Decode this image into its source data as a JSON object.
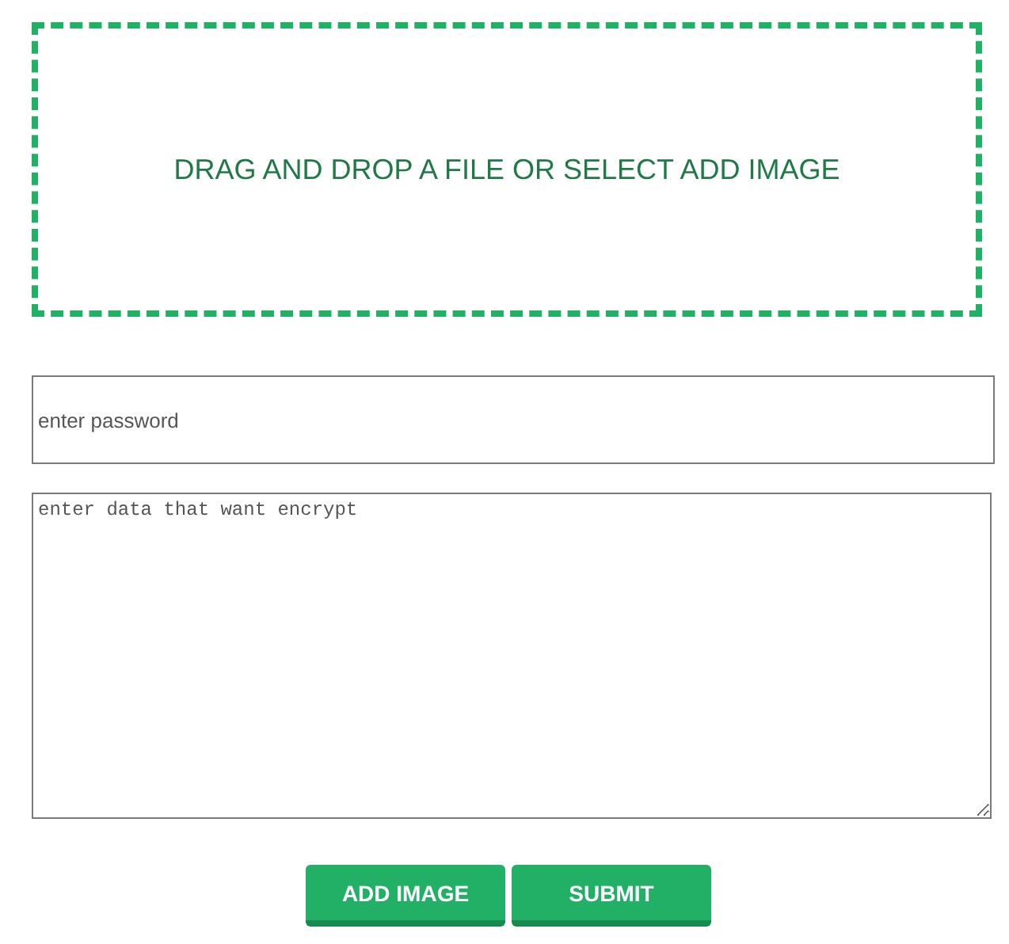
{
  "dropzone": {
    "text": "DRAG AND DROP A FILE OR SELECT ADD IMAGE"
  },
  "password_field": {
    "placeholder": "enter password"
  },
  "data_field": {
    "placeholder": "enter data that want encrypt"
  },
  "buttons": [
    {
      "label": "ADD IMAGE"
    },
    {
      "label": "SUBMIT"
    }
  ]
}
